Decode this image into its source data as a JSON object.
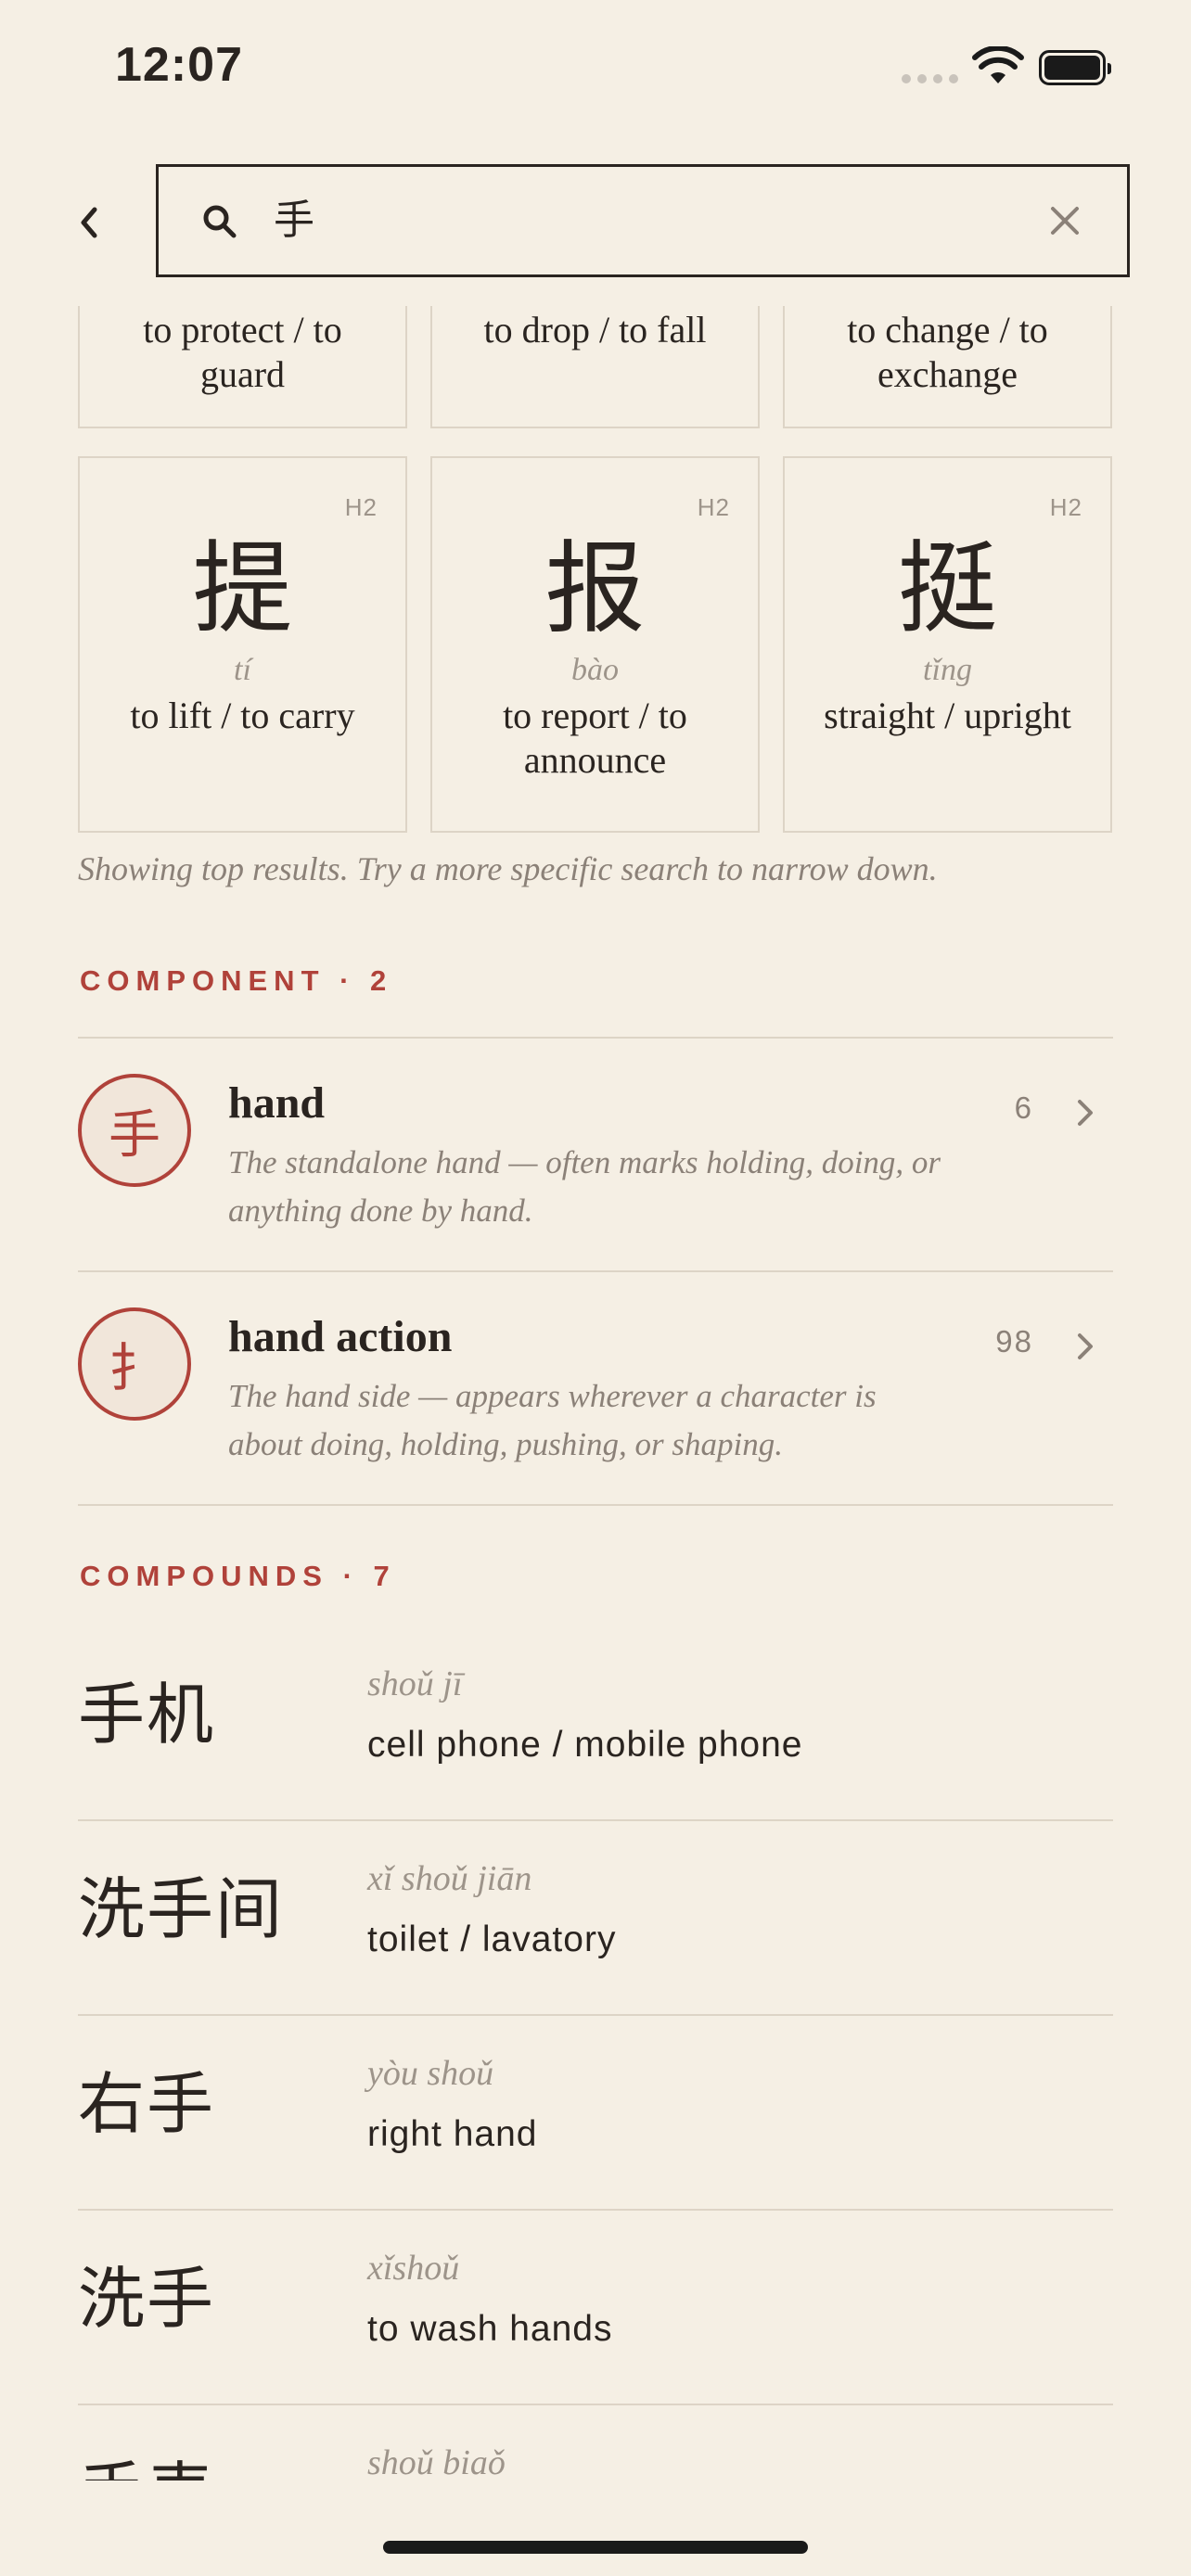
{
  "status": {
    "time": "12:07"
  },
  "search": {
    "query": "手"
  },
  "top_cut_tiles": [
    {
      "gloss": "to protect / to guard"
    },
    {
      "gloss": "to drop / to fall"
    },
    {
      "gloss": "to change / to exchange"
    }
  ],
  "tiles": [
    {
      "level": "H2",
      "hanzi": "提",
      "pinyin": "tí",
      "gloss": "to lift / to carry"
    },
    {
      "level": "H2",
      "hanzi": "报",
      "pinyin": "bào",
      "gloss": "to report / to announce"
    },
    {
      "level": "H2",
      "hanzi": "挺",
      "pinyin": "tǐng",
      "gloss": "straight / upright"
    }
  ],
  "note": "Showing top results. Try a more specific search to narrow down.",
  "component_section": {
    "label": "COMPONENT · 2"
  },
  "components": [
    {
      "glyph": "手",
      "name": "hand",
      "count": "6",
      "desc": "The standalone hand — often marks holding, doing, or anything done by hand."
    },
    {
      "glyph": "扌",
      "name": "hand action",
      "count": "98",
      "desc": "The hand side — appears wherever a character is about doing, holding, pushing, or shaping."
    }
  ],
  "compounds_section": {
    "label": "COMPOUNDS · 7"
  },
  "compounds": [
    {
      "hanzi": "手机",
      "pinyin": "shoǔ jī",
      "gloss": "cell phone / mobile phone"
    },
    {
      "hanzi": "洗手间",
      "pinyin": "xǐ shoǔ jiān",
      "gloss": "toilet / lavatory"
    },
    {
      "hanzi": "右手",
      "pinyin": "yòu shoǔ",
      "gloss": "right hand"
    },
    {
      "hanzi": "洗手",
      "pinyin": "xǐshoǔ",
      "gloss": "to wash hands"
    },
    {
      "hanzi": "手表",
      "pinyin": "shoǔ biaǒ",
      "gloss": ""
    }
  ],
  "icons": {
    "back": "chevron-left-icon",
    "search": "search-icon",
    "clear": "close-icon",
    "row": "chevron-right-icon"
  },
  "colors": {
    "background": "#f5efe4",
    "accent": "#b0423a",
    "text": "#2a2420",
    "muted": "#8b8178",
    "rule": "#ddd4c6"
  }
}
